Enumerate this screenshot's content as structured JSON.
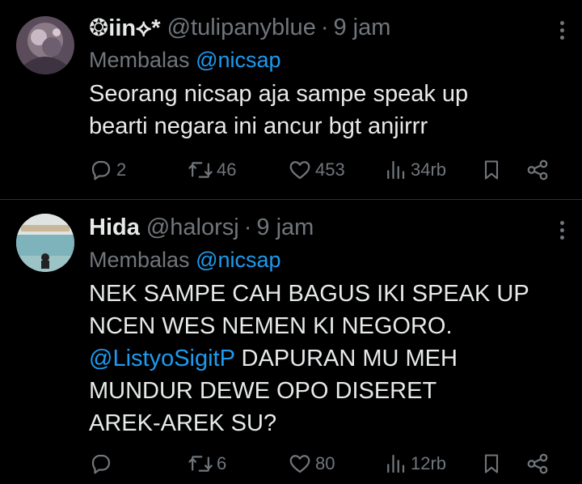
{
  "tweets": [
    {
      "display_name": "❂iin⟡*",
      "handle": "@tulipanyblue",
      "separator": "·",
      "time": "9 jam",
      "reply_prefix": "Membalas",
      "reply_to": "@nicsap",
      "body_line1": "Seorang nicsap aja sampe speak up",
      "body_line2": "bearti negara ini ancur bgt anjirrr",
      "replies": "2",
      "retweets": "46",
      "likes": "453",
      "views": "34rb"
    },
    {
      "display_name": "Hida",
      "handle": "@halorsj",
      "separator": "·",
      "time": "9 jam",
      "reply_prefix": "Membalas",
      "reply_to": "@nicsap",
      "body_line1": "NEK SAMPE CAH BAGUS IKI SPEAK UP",
      "body_line2": "NCEN WES NEMEN KI NEGORO.",
      "body_mention": "@ListyoSigitP",
      "body_line3_rest": " DAPURAN MU MEH",
      "body_line4": "MUNDUR DEWE OPO DISERET",
      "body_line5": "AREK-AREK SU?",
      "replies": "",
      "retweets": "6",
      "likes": "80",
      "views": "12rb"
    }
  ],
  "colors": {
    "background": "#000000",
    "text": "#e7e9ea",
    "muted": "#71767b",
    "link": "#1d9bf0",
    "divider": "#2f3336"
  },
  "icons": [
    "reply-icon",
    "retweet-icon",
    "like-icon",
    "views-icon",
    "bookmark-icon",
    "share-icon",
    "more-icon"
  ]
}
